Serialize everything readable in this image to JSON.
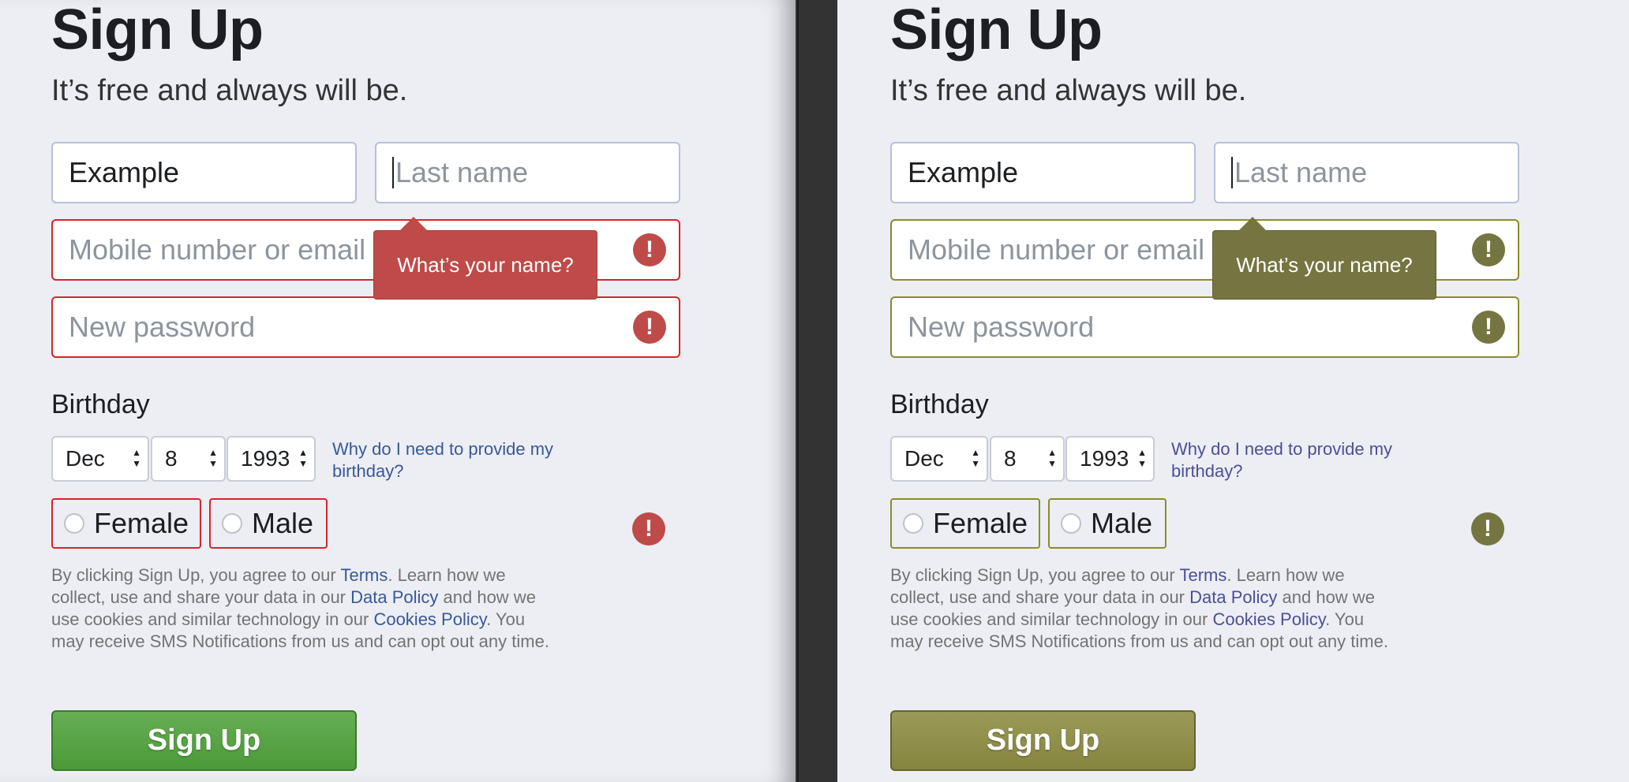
{
  "panels": [
    {
      "title": "Sign Up",
      "subtitle": "It’s free and always will be.",
      "first_name_value": "Example",
      "last_name_placeholder": "Last name",
      "mobile_placeholder": "Mobile number or email",
      "password_placeholder": "New password",
      "tooltip": "What’s your name?",
      "error_icon_glyph": "!",
      "birthday_label": "Birthday",
      "month": "Dec",
      "day": "8",
      "year": "1993",
      "why_link": "Why do I need to provide my birthday?",
      "female_label": "Female",
      "male_label": "Male",
      "terms": {
        "t1": "By clicking Sign Up, you agree to our ",
        "terms_link": "Terms",
        "t2": ". Learn how we collect, use and share your data in our ",
        "data_policy_link": "Data Policy",
        "t3": " and how we use cookies and similar technology in our ",
        "cookies_link": "Cookies Policy",
        "t4": ". You may receive SMS Notifications from us and can opt out any time."
      },
      "signup_label": "Sign Up",
      "colors": {
        "error": "#be4b49",
        "error_border": "#d9232c",
        "button": "#4b9a38",
        "link": "#385898"
      }
    },
    {
      "title": "Sign Up",
      "subtitle": "It’s free and always will be.",
      "first_name_value": "Example",
      "last_name_placeholder": "Last name",
      "mobile_placeholder": "Mobile number or email",
      "password_placeholder": "New password",
      "tooltip": "What’s your name?",
      "error_icon_glyph": "!",
      "birthday_label": "Birthday",
      "month": "Dec",
      "day": "8",
      "year": "1993",
      "why_link": "Why do I need to provide my birthday?",
      "female_label": "Female",
      "male_label": "Male",
      "terms": {
        "t1": "By clicking Sign Up, you agree to our ",
        "terms_link": "Terms",
        "t2": ". Learn how we collect, use and share your data in our ",
        "data_policy_link": "Data Policy",
        "t3": " and how we use cookies and similar technology in our ",
        "cookies_link": "Cookies Policy",
        "t4": ". You may receive SMS Notifications from us and can opt out any time."
      },
      "signup_label": "Sign Up",
      "colors": {
        "error": "#757541",
        "error_border": "#8c8c28",
        "button": "#85853f",
        "link": "#4b4f96"
      }
    }
  ]
}
